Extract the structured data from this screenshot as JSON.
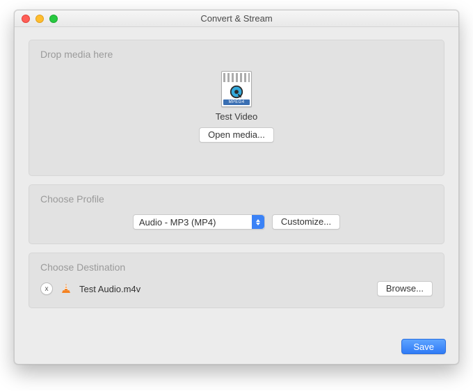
{
  "window": {
    "title": "Convert & Stream"
  },
  "drop": {
    "heading": "Drop media here",
    "media": {
      "format_tag": "MPEG4",
      "name": "Test Video"
    },
    "open_button": "Open media..."
  },
  "profile": {
    "heading": "Choose Profile",
    "selected": "Audio - MP3 (MP4)",
    "customize_button": "Customize..."
  },
  "destination": {
    "heading": "Choose Destination",
    "clear_label": "x",
    "filename": "Test Audio.m4v",
    "browse_button": "Browse..."
  },
  "footer": {
    "save_button": "Save"
  }
}
